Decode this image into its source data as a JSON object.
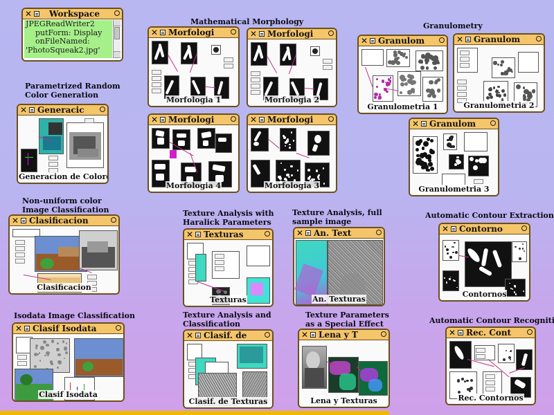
{
  "workspace": {
    "title": "Workspace",
    "lines": [
      "JPEGReadWriter2",
      "    putForm: Display",
      "    onFileNamed:",
      "'PhotoSqueak2.jpg'"
    ]
  },
  "section_labels": {
    "math_morph": "Mathematical Morphology",
    "granulometry": "Granulometry",
    "color_gen": "Parametrized Random\nColor Generation",
    "nonuniform": "Non-uniform color\nImage Classification",
    "haralick": "Texture Analysis with\nHaralick Parameters",
    "full_sample": "Texture Analysis, full\nsample image",
    "contour_ext": "Automatic Contour Extraction",
    "isodata": "Isodata Image Classification",
    "tex_class": "Texture Analysis and\nClassification",
    "tex_param": "Texture Parameters\nas a Special Effect",
    "contour_rec": "Automatic Contour Recognition"
  },
  "windows": [
    {
      "key": "morf1",
      "title": "Morfologi",
      "caption": "Morfologia 1"
    },
    {
      "key": "morf2",
      "title": "Morfologi",
      "caption": "Morfologia 2"
    },
    {
      "key": "morf4",
      "title": "Morfologi",
      "caption": "Morfologia 4"
    },
    {
      "key": "morf3",
      "title": "Morfologi",
      "caption": "Morfologia 3"
    },
    {
      "key": "gran1",
      "title": "Granulom",
      "caption": "Granulometria 1"
    },
    {
      "key": "gran2",
      "title": "Granulom",
      "caption": "Granulometria 2"
    },
    {
      "key": "gran3",
      "title": "Granulom",
      "caption": "Granulometria 3"
    },
    {
      "key": "gen",
      "title": "Generacic",
      "caption": "Generacion de Colores"
    },
    {
      "key": "clas",
      "title": "Clasificacion",
      "caption": "Clasificacion"
    },
    {
      "key": "text",
      "title": "Texturas",
      "caption": "Texturas"
    },
    {
      "key": "antext",
      "title": "An. Text",
      "caption": "An. Texturas"
    },
    {
      "key": "cont",
      "title": "Contorno",
      "caption": "Contornos"
    },
    {
      "key": "iso",
      "title": "Clasif Isodata",
      "caption": "Clasif Isodata"
    },
    {
      "key": "clasif",
      "title": "Clasif. de",
      "caption": "Clasif. de Texturas"
    },
    {
      "key": "lena",
      "title": "Lena y T",
      "caption": "Lena y Texturas"
    },
    {
      "key": "reccont",
      "title": "Rec. Cont",
      "caption": "Rec. Contornos"
    }
  ],
  "colors": {
    "desktop_top": "#b8b7f2",
    "desktop_bottom": "#cfa0ea",
    "titlebar": "#f5c56a",
    "window_border": "#6b4f1a",
    "workspace_bg": "#a6f08a",
    "wire": "#c0308a",
    "bottom_bar": "#f0b800"
  },
  "icons": {
    "close": "close-icon",
    "menu": "window-menu-icon",
    "collapse": "collapse-icon"
  }
}
